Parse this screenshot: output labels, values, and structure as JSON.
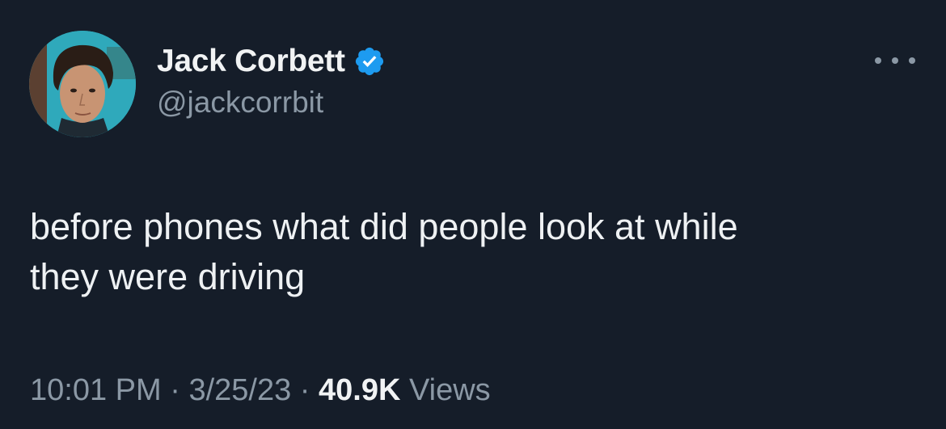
{
  "author": {
    "display_name": "Jack Corbett",
    "handle": "@jackcorrbit",
    "verified": true,
    "verified_icon": "verified-badge-icon",
    "avatar_icon": "profile-photo"
  },
  "tweet": {
    "text": "before phones what did people look at while\nthey were driving"
  },
  "meta": {
    "time": "10:01 PM",
    "separator": " · ",
    "date": "3/25/23",
    "views_count": "40.9K",
    "views_label": " Views"
  },
  "colors": {
    "background": "#151d29",
    "primary_text": "#e7e9ea",
    "secondary_text": "#8b98a5",
    "verified_blue": "#1d9bf0"
  },
  "actions": {
    "more_icon": "more-horizontal-icon"
  }
}
